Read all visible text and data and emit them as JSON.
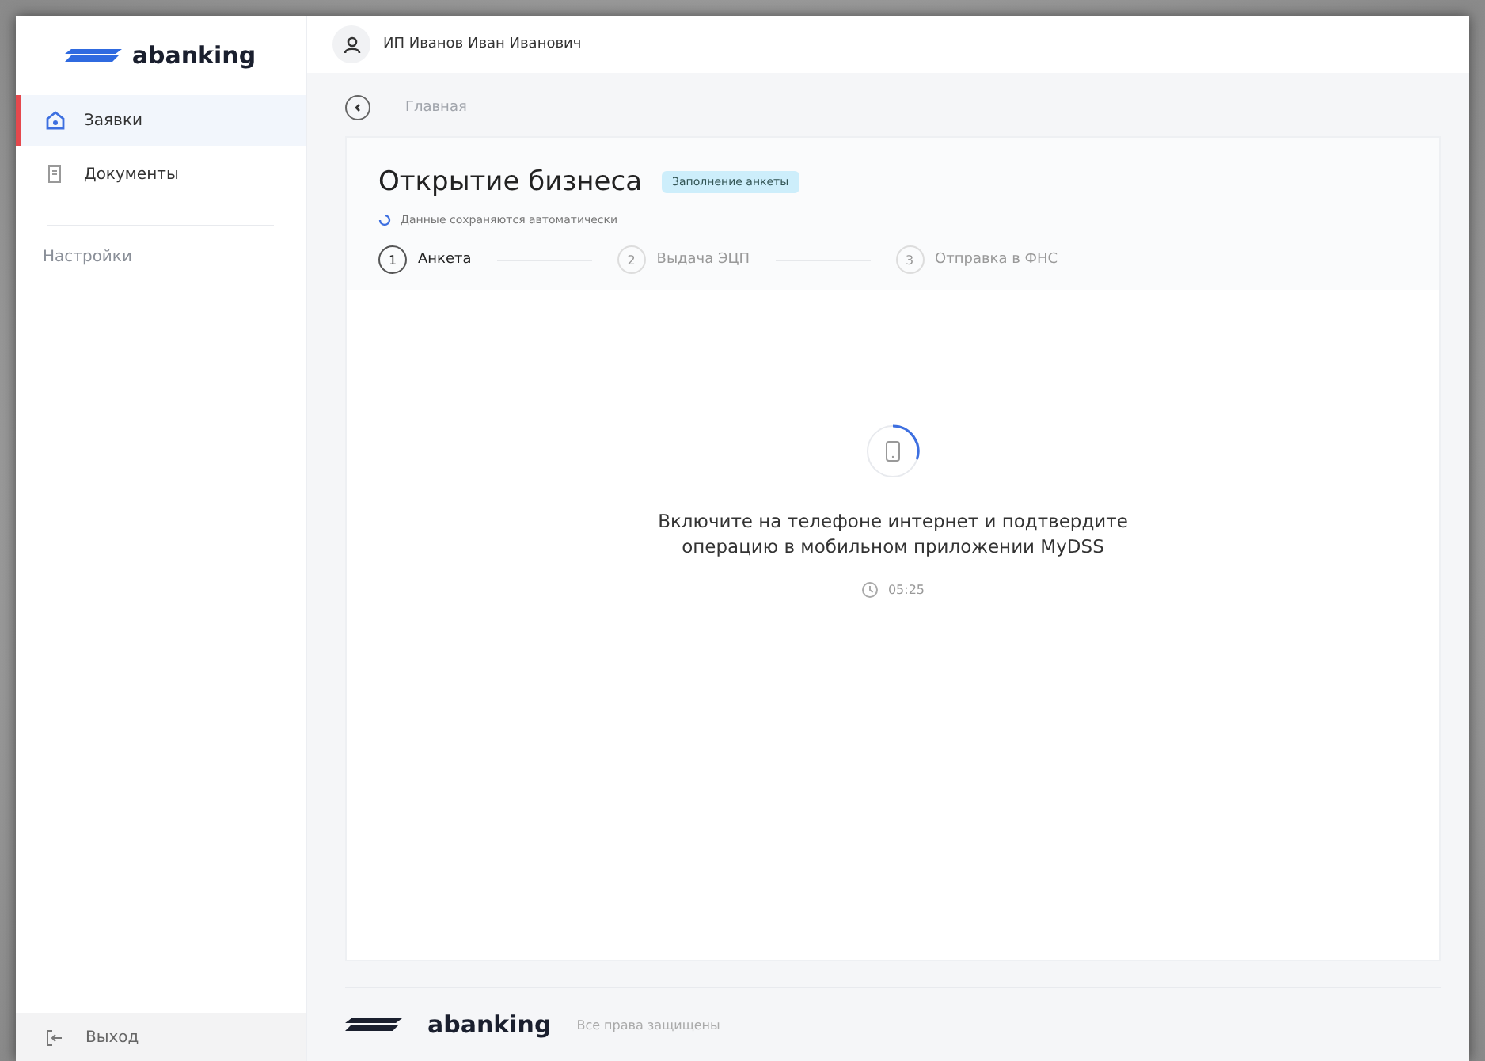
{
  "sidebar": {
    "logo": "abanking",
    "items": [
      {
        "label": "Заявки",
        "kind": "home",
        "selected": true
      },
      {
        "label": "Документы",
        "kind": "doc",
        "selected": false
      }
    ],
    "settings": "Настройки",
    "logout": "Выход"
  },
  "header": {
    "user": "ИП Иванов Иван Иванович"
  },
  "breadcrumb": "Главная",
  "card": {
    "title": "Открытие бизнеса",
    "badge": "Заполнение анкеты",
    "autosave": "Данные сохраняются автоматически",
    "steps": [
      {
        "number": "1",
        "label": "Анкета",
        "selected": true
      },
      {
        "number": "2",
        "label": "Выдача ЭЦП",
        "selected": false
      },
      {
        "number": "3",
        "label": "Отправка в ФНС",
        "selected": false
      }
    ],
    "message": "Включите на телефоне интернет и подтвердите операцию в мобильном приложении MyDSS",
    "timer": "05:25"
  },
  "footer": {
    "logo": "abanking",
    "copyright": "Все права защищены"
  }
}
